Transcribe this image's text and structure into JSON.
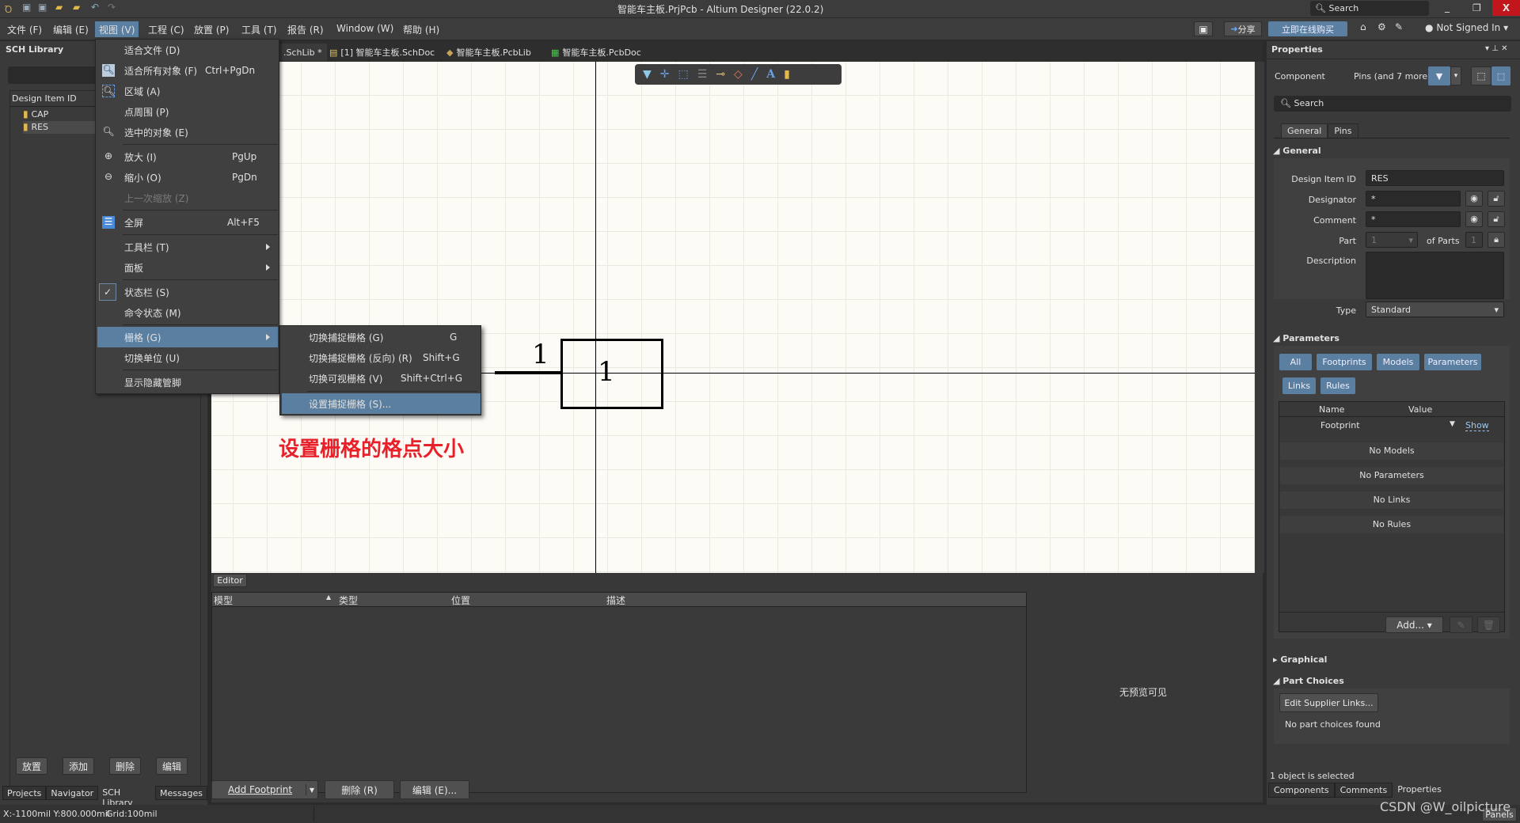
{
  "window": {
    "title": "智能车主板.PrjPcb - Altium Designer (22.0.2)",
    "search_placeholder": "Search",
    "minimize": "_",
    "restore": "❐",
    "close": "X"
  },
  "menubar": [
    "文件 (F)",
    "编辑 (E)",
    "视图 (V)",
    "工程 (C)",
    "放置 (P)",
    "工具 (T)",
    "报告 (R)",
    "Window (W)",
    "帮助 (H)"
  ],
  "toolbar_right": {
    "share": "分享",
    "buy": "立即在线购买",
    "user": "Not Signed In"
  },
  "doc_tabs": [
    {
      "label": ".SchLib *",
      "active": true
    },
    {
      "label": "[1] 智能车主板.SchDoc"
    },
    {
      "label": "智能车主板.PcbLib"
    },
    {
      "label": "智能车主板.PcbDoc"
    }
  ],
  "left_panel": {
    "title": "SCH Library",
    "column": "Design Item ID",
    "items": [
      "CAP",
      "RES"
    ],
    "selected": "RES",
    "buttons": [
      "放置",
      "添加",
      "删除",
      "编辑"
    ],
    "tabs": [
      "Projects",
      "Navigator",
      "SCH Library",
      "Messages"
    ],
    "active_tab": "SCH Library"
  },
  "view_menu": {
    "items": [
      {
        "label": "适合文件 (D)",
        "shortcut": "",
        "icon": ""
      },
      {
        "label": "适合所有对象 (F)",
        "shortcut": "Ctrl+PgDn",
        "icon": "fit-all-icon"
      },
      {
        "label": "区域 (A)",
        "shortcut": "",
        "icon": "zoom-area-icon"
      },
      {
        "label": "点周围 (P)",
        "shortcut": "",
        "icon": ""
      },
      {
        "label": "选中的对象 (E)",
        "shortcut": "",
        "icon": "zoom-selected-icon"
      },
      {
        "label": "放大 (I)",
        "shortcut": "PgUp",
        "icon": "zoom-in-icon"
      },
      {
        "label": "缩小 (O)",
        "shortcut": "PgDn",
        "icon": "zoom-out-icon"
      },
      {
        "label": "上一次缩放 (Z)",
        "shortcut": "",
        "disabled": true
      },
      {
        "label": "全屏",
        "shortcut": "Alt+F5",
        "icon": "fullscreen-icon"
      },
      {
        "label": "工具栏 (T)",
        "submenu": true
      },
      {
        "label": "面板",
        "submenu": true
      },
      {
        "label": "状态栏 (S)",
        "checked": true
      },
      {
        "label": "命令状态 (M)"
      },
      {
        "label": "栅格 (G)",
        "submenu": true,
        "highlighted": true
      },
      {
        "label": "切换单位 (U)"
      },
      {
        "label": "显示隐藏管脚"
      }
    ]
  },
  "grid_submenu": {
    "items": [
      {
        "label": "切换捕捉栅格 (G)",
        "shortcut": "G"
      },
      {
        "label": "切换捕捉栅格 (反向) (R)",
        "shortcut": "Shift+G"
      },
      {
        "label": "切换可视栅格 (V)",
        "shortcut": "Shift+Ctrl+G"
      },
      {
        "label": "设置捕捉栅格 (S)...",
        "shortcut": "",
        "highlighted": true
      }
    ]
  },
  "canvas": {
    "pin_number": "1",
    "pin_name": "1",
    "annotation": "设置栅格的格点大小",
    "annotation_color": "#e8202a"
  },
  "editor": {
    "tab": "Editor",
    "columns": [
      "模型",
      "类型",
      "位置",
      "描述"
    ],
    "no_preview": "无预览可见",
    "buttons": {
      "add_footprint": "Add Footprint",
      "delete": "删除 (R)",
      "edit": "编辑 (E)..."
    }
  },
  "properties": {
    "title": "Properties",
    "component_label": "Component",
    "filter_label": "Pins (and 7 more)",
    "search_placeholder": "Search",
    "tabs": [
      "General",
      "Pins"
    ],
    "general": {
      "heading": "General",
      "design_item_id_label": "Design Item ID",
      "design_item_id": "RES",
      "designator_label": "Designator",
      "designator": "*",
      "comment_label": "Comment",
      "comment": "*",
      "part_label": "Part",
      "part": "1",
      "of_parts_label": "of Parts",
      "of_parts": "1",
      "description_label": "Description",
      "description": "",
      "type_label": "Type",
      "type": "Standard"
    },
    "parameters": {
      "heading": "Parameters",
      "filters": [
        "All",
        "Footprints",
        "Models",
        "Parameters",
        "Links",
        "Rules"
      ],
      "columns": [
        "Name",
        "Value"
      ],
      "footprint_row": {
        "name": "Footprint",
        "value": "Show"
      },
      "empty_rows": [
        "No Models",
        "No Parameters",
        "No Links",
        "No Rules"
      ],
      "add_button": "Add..."
    },
    "graphical": "Graphical",
    "part_choices": {
      "heading": "Part Choices",
      "button": "Edit Supplier Links...",
      "empty": "No part choices found"
    },
    "selection_status": "1 object is selected",
    "bottom_tabs": [
      "Components",
      "Comments",
      "Properties"
    ],
    "active_tab": "Properties"
  },
  "status": {
    "coords": "X:-1100mil Y:800.000mil",
    "grid": "Grid:100mil",
    "panels": "Panels"
  },
  "watermark": "CSDN @W_oilpicture",
  "colors": {
    "accent": "#5b7fa0",
    "background": "#3a3a3a",
    "canvas": "#fdfbf6",
    "close": "#c0161c"
  }
}
